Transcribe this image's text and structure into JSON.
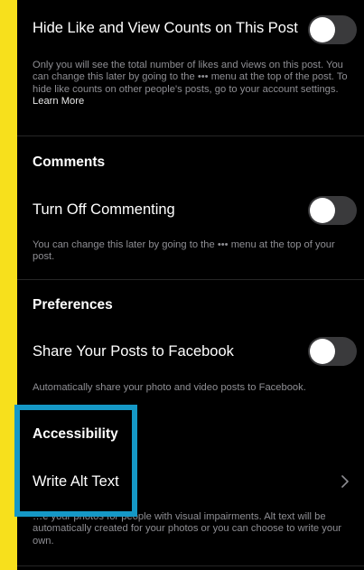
{
  "colors": {
    "accent_strip": "#f7e01c",
    "highlight": "#1598c6"
  },
  "hide_counts": {
    "label": "Hide Like and View Counts on This Post",
    "description": "Only you will see the total number of likes and views on this post. You can change this later by going to the ••• menu at the top of the post. To hide like counts on other people's posts, go to your account settings.",
    "link": "Learn More"
  },
  "comments": {
    "header": "Comments",
    "label": "Turn Off Commenting",
    "description": "You can change this later by going to the ••• menu at the top of your post."
  },
  "preferences": {
    "header": "Preferences",
    "label": "Share Your Posts to Facebook",
    "description": "Automatically share your photo and video posts to Facebook."
  },
  "accessibility": {
    "header": "Accessibility",
    "label": "Write Alt Text",
    "description_visible": "…e your photos for people with visual impairments. Alt text will be automatically created for your photos or you can choose to write your own."
  }
}
